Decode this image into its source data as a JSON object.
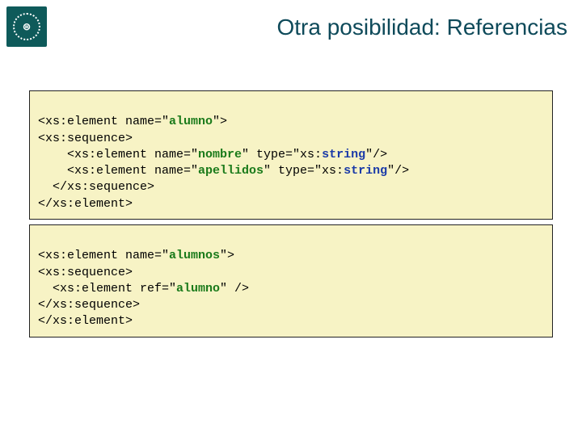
{
  "title": "Otra posibilidad: Referencias",
  "logo_glyph": "⊜",
  "code1": {
    "l1a": "<xs:element name=\"",
    "l1b": "alumno",
    "l1c": "\">",
    "l2": "<xs:sequence>",
    "l3a": "<xs:element name=\"",
    "l3b": "nombre",
    "l3c": "\" type=\"xs:",
    "l3d": "string",
    "l3e": "\"/>",
    "l4a": "<xs:element name=\"",
    "l4b": "apellidos",
    "l4c": "\" type=\"xs:",
    "l4d": "string",
    "l4e": "\"/>",
    "l5": "</xs:sequence>",
    "l6": "</xs:element>"
  },
  "code2": {
    "l1a": "<xs:element name=\"",
    "l1b": "alumnos",
    "l1c": "\">",
    "l2": "<xs:sequence>",
    "l3a": "<xs:element ref=\"",
    "l3b": "alumno",
    "l3c": "\" />",
    "l4": "</xs:sequence>",
    "l5": "</xs:element>"
  }
}
